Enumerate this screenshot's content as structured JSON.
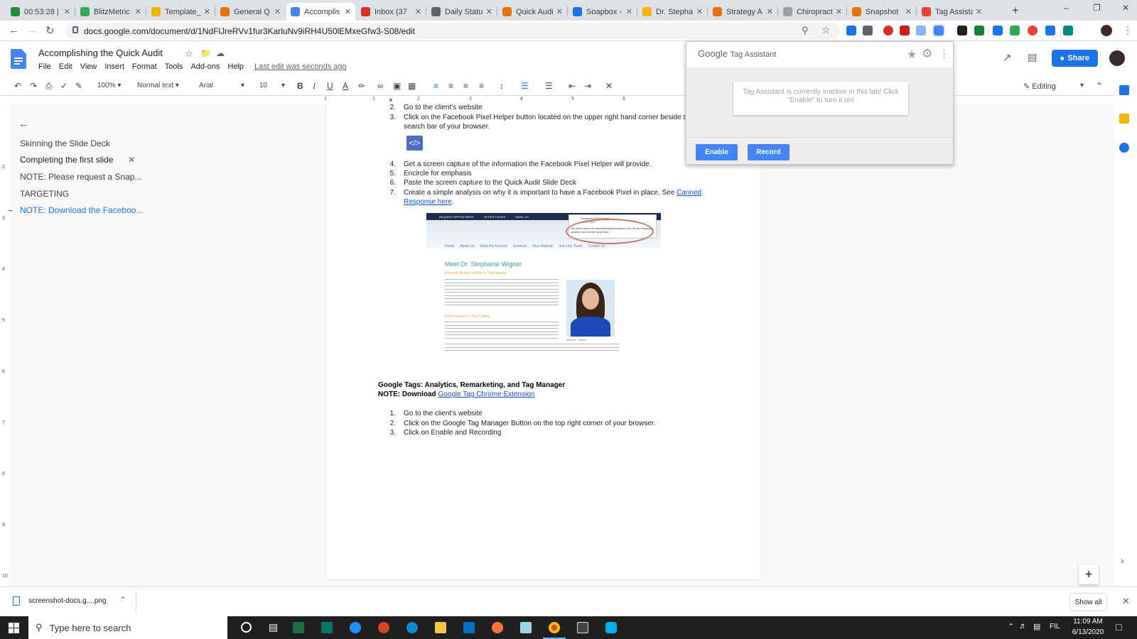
{
  "browser": {
    "tabs": [
      {
        "label": "00:53:28 |",
        "icon": "timer-icon",
        "color": "#1e8e3e"
      },
      {
        "label": "BlitzMetric",
        "icon": "drive-icon",
        "color": "#34a853"
      },
      {
        "label": "Template_",
        "icon": "slides-icon",
        "color": "#f4b400"
      },
      {
        "label": "General Q",
        "icon": "orange-circle-icon",
        "color": "#e8710a"
      },
      {
        "label": "Accomplis",
        "icon": "docs-icon",
        "color": "#4285f4"
      },
      {
        "label": "Inbox (37",
        "icon": "gmail-icon",
        "color": "#d93025"
      },
      {
        "label": "Daily Statu",
        "icon": "globe-icon",
        "color": "#5f6368"
      },
      {
        "label": "Quick Audi",
        "icon": "orange-circle-icon",
        "color": "#e8710a"
      },
      {
        "label": "Soapbox -",
        "icon": "soapbox-icon",
        "color": "#1a73e8"
      },
      {
        "label": "Dr. Stepha",
        "icon": "folder-icon",
        "color": "#f4b400"
      },
      {
        "label": "Strategy A",
        "icon": "orange-circle-icon",
        "color": "#e8710a"
      },
      {
        "label": "Chiropract",
        "icon": "plus-icon",
        "color": "#9aa0a6"
      },
      {
        "label": "Snapshot",
        "icon": "orange-circle-icon",
        "color": "#e8710a"
      },
      {
        "label": "Tag Assista",
        "icon": "tag-assistant-icon",
        "color": "#ea4335"
      }
    ],
    "url": "docs.google.com/document/d/1NdFlJreRVv1fur3KarluNv9iRH4U50lEMxeGfw3-S08/edit",
    "new_tab_glyph": "+"
  },
  "docs": {
    "title": "Accomplishing the Quick Audit",
    "menu": [
      "File",
      "Edit",
      "View",
      "Insert",
      "Format",
      "Tools",
      "Add-ons",
      "Help"
    ],
    "last_edit": "Last edit was seconds ago",
    "share_label": "Share",
    "zoom": "100%",
    "style": "Normal text",
    "font": "Arial",
    "font_size": "10",
    "mode": "Editing"
  },
  "ruler": {
    "marks": [
      "1",
      "1",
      "2",
      "3",
      "4",
      "5",
      "6"
    ],
    "left_marks": [
      "2",
      "3",
      "4",
      "5",
      "6",
      "7",
      "8",
      "9",
      "10"
    ]
  },
  "outline": {
    "items": [
      {
        "label": "Skinning the Slide Deck",
        "active": false
      },
      {
        "label": "Completing the first slide",
        "active": false
      },
      {
        "label": "NOTE: Please request a Snap...",
        "active": false
      },
      {
        "label": "TARGETING",
        "active": false
      },
      {
        "label": "NOTE: Download the Faceboo...",
        "active": true
      }
    ]
  },
  "document": {
    "list1": [
      {
        "n": "2.",
        "text": "Go to the client's website"
      },
      {
        "n": "3.",
        "text": "Click on the Facebook Pixel Helper button located on the upper right hand corner beside the",
        "cont": "search bar of your browser."
      },
      {
        "n": "4.",
        "text": "Get a screen capture of the information the Facebook Pixel Helper will provide."
      },
      {
        "n": "5.",
        "text": "Encircle for emphasis"
      },
      {
        "n": "6.",
        "text": "Paste the screen capture to the Quick Audit Slide Deck"
      },
      {
        "n": "7.",
        "text": "Create a simple analysis on why it is important to have a Facebook Pixel in place. See ",
        "link": "Canned",
        "cont": "Response here",
        "cont_tail": "."
      }
    ],
    "heading": "Google Tags: Analytics, Remarketing, and Tag Manager",
    "note_prefix": "NOTE: Download ",
    "note_link": "Google Tag Chrome Extension",
    "list2": [
      {
        "n": "1.",
        "text": "Go to the client's website"
      },
      {
        "n": "2.",
        "text": "Click on the Google Tag Manager Button on the top right corner of your browser."
      },
      {
        "n": "3.",
        "text": "Click on Enable and Recording"
      }
    ],
    "embedded": {
      "topbar": [
        "REQUEST APPOINTMENT",
        "OFFICE HOURS",
        "EMAIL US"
      ],
      "pixel_helper_title": "Facebook Pixel Helper",
      "pixel_helper_sub": "Learn More",
      "pixel_helper_msg": "No pixels found on www.drstephaniewigner.com. An and tracking solution can convert pixel flow.",
      "nav": [
        "Home",
        "About Us",
        "Meet the Doctors",
        "Services",
        "New Patients",
        "Join Our Team",
        "Contact Us"
      ],
      "heading": "Meet Dr. Stephanie Wigner",
      "subheading": "A Family Illness Led Me to Chiropractic",
      "subheading2": "From Interest to True Calling",
      "caption": "Meet Dr. Wigner"
    }
  },
  "tag_assistant": {
    "brand": "Google",
    "product": "Tag Assistant",
    "message": "Tag Assistant is currently inactive in this tab! Click \"Enable\" to turn it on!",
    "enable_label": "Enable",
    "record_label": "Record"
  },
  "downloads": {
    "file": "screenshot-docs.g....png",
    "show_all": "Show all"
  },
  "taskbar": {
    "search_placeholder": "Type here to search",
    "lang": "FIL",
    "time": "11:09 AM",
    "date": "6/13/2020"
  },
  "colors": {
    "accent": "#1a73e8",
    "enable_btn": "#4285f4"
  }
}
